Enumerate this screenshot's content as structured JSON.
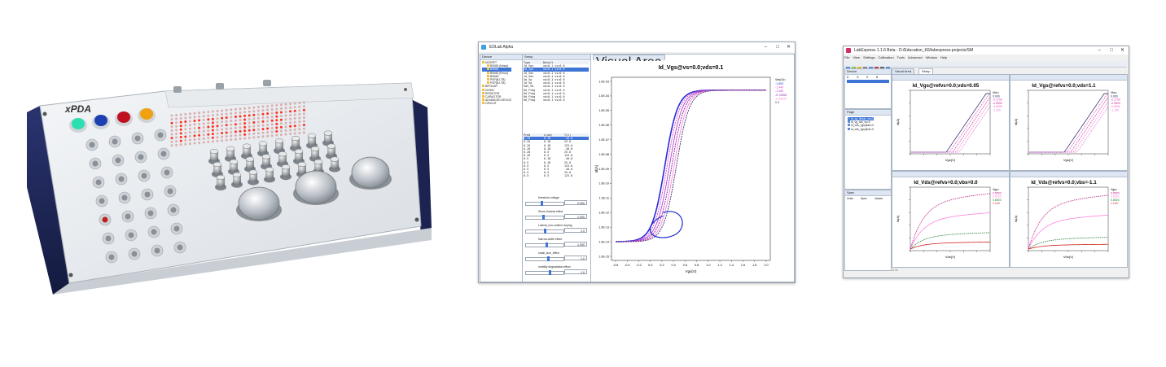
{
  "device": {
    "brand_text": "xPDA"
  },
  "app1": {
    "title": "EDLab Alpha",
    "panels": {
      "device": "Device",
      "setup": "Setup",
      "drawing": "Visual Area"
    },
    "tree": [
      "MOSFET",
      "BSIM3 (Nmos)",
      "BSIM4",
      "BSIM3 (Pmos)",
      "BSIMS",
      "PSP(BJ-TB)",
      "PSP(BJ-TB)",
      "BIPOLAR",
      "DIODE",
      "RESISTOR",
      "CAPACITOR",
      "ADVANCED DEVICE",
      "CIRCUIT"
    ],
    "setup_cols": [
      "Type",
      "Detail"
    ],
    "setup_rows": [
      [
        "Id_Vgs",
        "vd=0.1 vs=0 0"
      ],
      [
        "Id_Vgs",
        "vd=0.1 vs=0 0"
      ],
      [
        "Id_Vds",
        "vd=0.1 vs=0 0"
      ],
      [
        "Id_Vds",
        "vd=0.1 vs=0 0"
      ],
      [
        "Gm_Vg",
        "vd=0.1 vs=0 0"
      ],
      [
        "Id_Vg",
        "vd=0.1 vs=0 0"
      ],
      [
        "Gds_Vd",
        "vd=0.1 vs=0 0"
      ],
      [
        "Rd_Ftbg",
        "vd=0.1 vs=0 0"
      ],
      [
        "Rd_Ftbg",
        "vd=0.1 vs=0 0"
      ],
      [
        "Rd_Ftbg",
        "vd=0.1 vs=0 0"
      ],
      [
        "Rd_Ftbg",
        "vd=0.1 vs=0 0"
      ]
    ],
    "table2_cols": [
      "Pred",
      "L(um)",
      "T(c)"
    ],
    "table2_rows": [
      [
        "0.20",
        "0.18",
        "-40.0"
      ],
      [
        "0.20",
        "0.18",
        "25.0"
      ],
      [
        "0.20",
        "0.18",
        "125.0"
      ],
      [
        "0.20",
        "0.18",
        "-40.0"
      ],
      [
        "0.20",
        "0.5",
        "25.0"
      ],
      [
        "0.20",
        "0.5",
        "125.0"
      ],
      [
        "0.5",
        "0.18",
        "-40.0"
      ],
      [
        "0.5",
        "0.18",
        "25.0"
      ],
      [
        "0.5",
        "0.5",
        "125.0"
      ],
      [
        "0.5",
        "0.5",
        "-40.0"
      ],
      [
        "0.5",
        "0.5",
        "25.0"
      ],
      [
        "0.5",
        "0.5",
        "125.0"
      ]
    ],
    "params": [
      {
        "label": "threshold voltage",
        "value": "0.000"
      },
      {
        "label": "Short-channel effect",
        "value": "1.000"
      },
      {
        "label": "Lateral_non-uniform doping",
        "value": "1.0"
      },
      {
        "label": "Narrow-width effect",
        "value": "1.000"
      },
      {
        "label": "small_size_effect",
        "value": "1.0"
      },
      {
        "label": "mobility degradation effect",
        "value": "1.0"
      }
    ],
    "chart_data": {
      "type": "line",
      "title": "Id_Vgs@vs=0.0;vds=0.1",
      "xlabel": "Vgs(V)",
      "ylabel": "Id(A)",
      "ylog": true,
      "xlim": [
        -0.6,
        1.2
      ],
      "xticks": [
        "-0.6",
        "-0.4",
        "-0.2",
        "0.0",
        "0.2",
        "0.4",
        "0.6",
        "0.8",
        "1.0",
        "1.2",
        "1.4",
        "1.6",
        "1.8",
        "2.0"
      ],
      "yticks": [
        "1.0E-03",
        "1.0E-04",
        "1.0E-05",
        "1.0E-06",
        "1.0E-07",
        "1.0E-08",
        "1.0E-09",
        "1.0E-10",
        "1.0E-11",
        "1.0E-12",
        "1.0E-13",
        "1.0E-14",
        "1.0E-15"
      ],
      "legend_title": "Vbs(V)=",
      "legend": [
        "-1.800",
        "-1.440",
        "-1.080",
        "-0.72000",
        "-0.36000",
        "0.0"
      ],
      "series_colors": [
        "#2a2ad8",
        "#e040c0",
        "#b040d0",
        "#8020a0",
        "#ff80e0",
        "#303070"
      ]
    }
  },
  "app2": {
    "title": "LabExpress 1.1.6 Beta - D:/Education_K0/labexpress-projects/SM",
    "menu": [
      "File",
      "View",
      "Settings",
      "Calibration",
      "Tools",
      "Advanced",
      "Window",
      "Help"
    ],
    "panels": {
      "device": "Device",
      "page": "Page",
      "spec": "Spec",
      "drawing": "Visual Area",
      "setup": "Setup"
    },
    "device_cols": [
      "D",
      "G",
      "S",
      "B"
    ],
    "pages": [
      "id_vg_linear_vs=0",
      "id_vg_sat_vs=0",
      "id_vds_vgs@ad=0",
      "id_vds_vgs@vb=0"
    ],
    "spec_cols": [
      "Units",
      "Spec",
      "Values"
    ],
    "status": "1 / 1",
    "chart_data": [
      {
        "type": "line",
        "title": "Id_Vgs@refvs=0.0;vds=0.05",
        "xlabel": "Vgs(V)",
        "ylabel": "Id(A)",
        "legend_title": "Vbs=",
        "legend": [
          "0.000",
          "-0.2750",
          "-0.5500",
          "-0.8250",
          "-1.100"
        ]
      },
      {
        "type": "line",
        "title": "Id_Vgs@refvs=0.0;vds=1.1",
        "xlabel": "Vgs(V)",
        "ylabel": "Id(A)",
        "legend_title": "Vbs=",
        "legend": [
          "0.000",
          "-0.2750",
          "-0.5500",
          "-0.8250",
          "-1.100"
        ]
      },
      {
        "type": "line",
        "title": "Id_Vds@refvs=0.0;vbs=0.0",
        "xlabel": "Vds(V)",
        "ylabel": "Id(A)",
        "legend_title": "Vgs=",
        "legend": [
          "0.5500",
          "0.8250",
          "0.8500",
          "1.100"
        ]
      },
      {
        "type": "line",
        "title": "Id_Vds@refvs=0.0;vbs=-1.1",
        "xlabel": "Vds(V)",
        "ylabel": "Id(A)",
        "legend_title": "Vgs=",
        "legend": [
          "0.5500",
          "0.8250",
          "0.8500",
          "1.100"
        ]
      }
    ]
  }
}
